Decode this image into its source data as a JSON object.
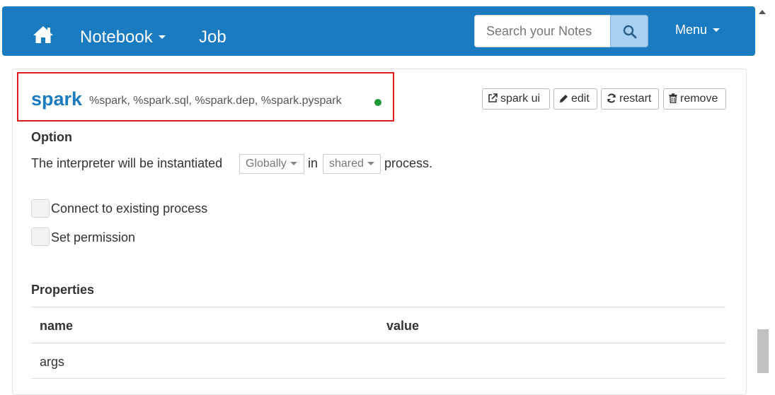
{
  "navbar": {
    "brand_icon": "home-icon",
    "notebook_label": "Notebook",
    "job_label": "Job",
    "search": {
      "placeholder": "Search your Notes",
      "icon": "search-icon"
    },
    "menu_label": "Menu",
    "background_color": "#1a7bc1"
  },
  "interpreter": {
    "name": "spark",
    "bindings": "%spark, %spark.sql, %spark.dep, %spark.pyspark",
    "status_color": "#1f9a3b",
    "buttons": {
      "spark_ui": "spark ui",
      "edit": "edit",
      "restart": "restart",
      "remove": "remove"
    },
    "option": {
      "heading": "Option",
      "sentence_start": "The interpreter will be instantiated",
      "instantiation_mode": "Globally",
      "sentence_mid": "in",
      "process_mode": "shared",
      "sentence_end": "process.",
      "connect_existing_label": "Connect to existing process",
      "set_permission_label": "Set permission"
    },
    "properties": {
      "heading": "Properties",
      "columns": [
        "name",
        "value"
      ],
      "rows": [
        {
          "name": "args",
          "value": ""
        }
      ]
    }
  }
}
